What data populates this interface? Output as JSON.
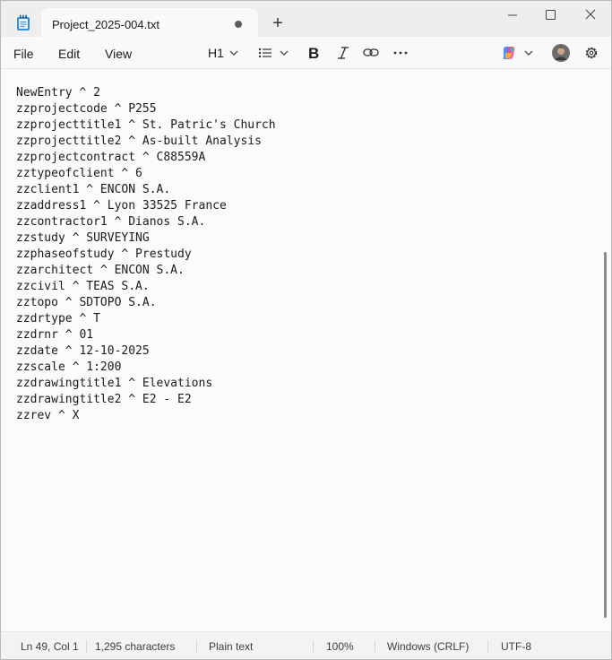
{
  "tab": {
    "title": "Project_2025-004.txt",
    "modified_icon": "unsaved-dot-icon"
  },
  "titlebar": {
    "new_tab_label": "+"
  },
  "menu": {
    "file": "File",
    "edit": "Edit",
    "view": "View"
  },
  "toolbar": {
    "heading_label": "H1"
  },
  "document": {
    "lines": [
      "NewEntry ^ 2",
      "zzprojectcode ^ P255",
      "zzprojecttitle1 ^ St. Patric's Church",
      "zzprojecttitle2 ^ As-built Analysis",
      "zzprojectcontract ^ C88559A",
      "zztypeofclient ^ 6",
      "zzclient1 ^ ENCON S.A.",
      "zzaddress1 ^ Lyon 33525 France",
      "zzcontractor1 ^ Dianos S.A.",
      "zzstudy ^ SURVEYING",
      "zzphaseofstudy ^ Prestudy",
      "zzarchitect ^ ENCON S.A.",
      "zzcivil ^ TEAS S.A.",
      "zztopo ^ SDTOPO S.A.",
      "zzdrtype ^ T",
      "zzdrnr ^ 01",
      "zzdate ^ 12-10-2025",
      "zzscale ^ 1:200",
      "zzdrawingtitle1 ^ Elevations",
      "zzdrawingtitle2 ^ E2 - E2",
      "zzrev ^ X"
    ]
  },
  "status": {
    "position": "Ln 49, Col 1",
    "characters": "1,295 characters",
    "format": "Plain text",
    "zoom": "100%",
    "line_ending": "Windows (CRLF)",
    "encoding": "UTF-8"
  },
  "colors": {
    "copilot": [
      "#e24f9b",
      "#4f8ef7",
      "#f7b23b",
      "#45c07a"
    ]
  }
}
